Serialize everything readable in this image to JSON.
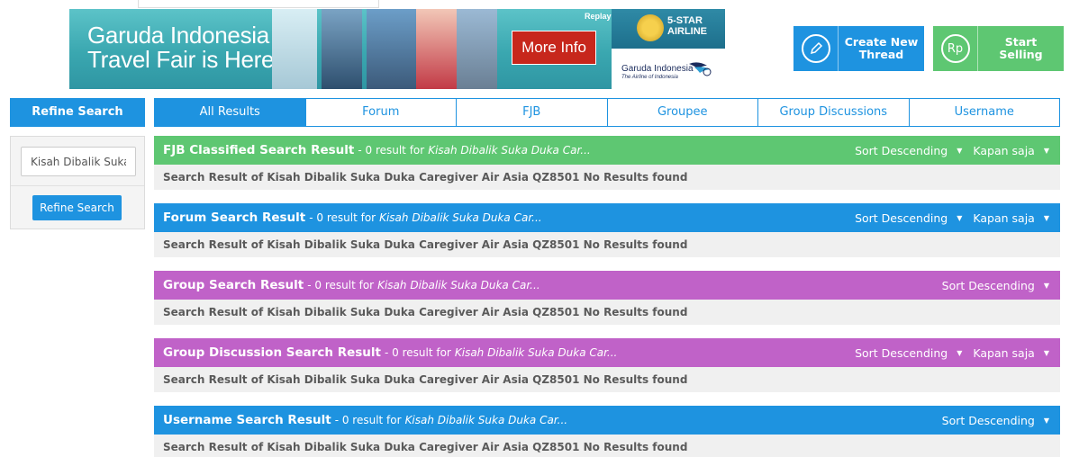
{
  "banner": {
    "headline_line1": "Garuda Indonesia",
    "headline_line2": "Travel Fair is Here",
    "more_info": "More Info",
    "replay": "Replay",
    "star_line1": "5-STAR",
    "star_line2": "AIRLINE",
    "brand": "Garuda Indonesia",
    "tagline": "The Airline of Indonesia"
  },
  "actions": {
    "create_label": "Create New Thread",
    "sell_icon": "Rp",
    "sell_label": "Start Selling"
  },
  "sidebar": {
    "heading": "Refine Search",
    "input_value": "Kisah Dibalik Suka",
    "button_label": "Refine Search"
  },
  "tabs": [
    "All Results",
    "Forum",
    "FJB",
    "Groupee",
    "Group Discussions",
    "Username"
  ],
  "sections": [
    {
      "title": "FJB Classified Search Result",
      "count": "- 0 result for",
      "query": "Kisah Dibalik Suka Duka Car...",
      "sort": "Sort Descending",
      "time": "Kapan saja",
      "body": "Search Result of Kisah Dibalik Suka Duka Caregiver Air Asia QZ8501 No Results found",
      "color": "#5ec772"
    },
    {
      "title": "Forum Search Result",
      "count": "- 0 result for",
      "query": "Kisah Dibalik Suka Duka Car...",
      "sort": "Sort Descending",
      "time": "Kapan saja",
      "body": "Search Result of Kisah Dibalik Suka Duka Caregiver Air Asia QZ8501 No Results found",
      "color": "#1e93e0"
    },
    {
      "title": "Group Search Result",
      "count": "- 0 result for",
      "query": "Kisah Dibalik Suka Duka Car...",
      "sort": "Sort Descending",
      "time": "",
      "body": "Search Result of Kisah Dibalik Suka Duka Caregiver Air Asia QZ8501 No Results found",
      "color": "#c062c8"
    },
    {
      "title": "Group Discussion Search Result",
      "count": "- 0 result for",
      "query": "Kisah Dibalik Suka Duka Car...",
      "sort": "Sort Descending",
      "time": "Kapan saja",
      "body": "Search Result of Kisah Dibalik Suka Duka Caregiver Air Asia QZ8501 No Results found",
      "color": "#c062c8"
    },
    {
      "title": "Username Search Result",
      "count": "- 0 result for",
      "query": "Kisah Dibalik Suka Duka Car...",
      "sort": "Sort Descending",
      "time": "",
      "body": "Search Result of Kisah Dibalik Suka Duka Caregiver Air Asia QZ8501 No Results found",
      "color": "#1e93e0"
    }
  ]
}
